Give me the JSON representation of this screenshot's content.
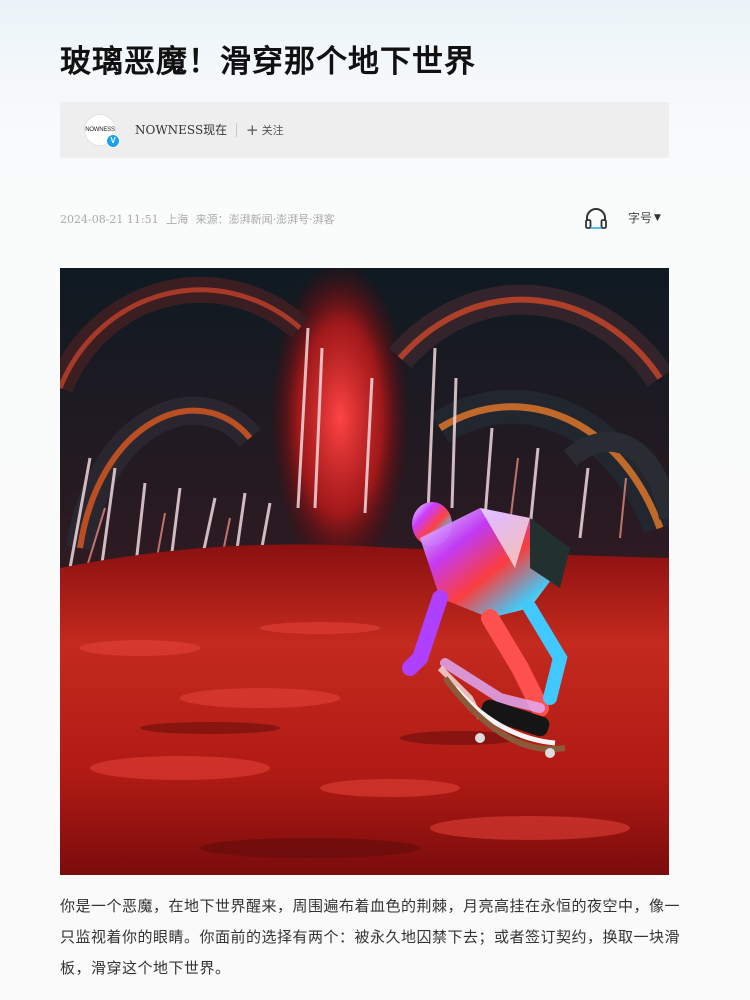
{
  "article": {
    "title": "玻璃恶魔！滑穿那个地下世界",
    "author": {
      "avatar_text": "NOWNESS",
      "verified_badge": "V",
      "name": "NOWNESS现在",
      "follow_label": "关注",
      "follow_icon": "plus-icon"
    },
    "meta": {
      "datetime": "2024-08-21 11:51",
      "location": "上海",
      "source": "来源：澎湃新闻·澎湃号·湃客"
    },
    "toolbar": {
      "audio_icon": "headphone-icon",
      "font_size_label": "字号",
      "font_size_icon": "caret-down-icon"
    },
    "hero_image": {
      "subject": "glass-demon-skateboarder-illustration"
    },
    "body": "你是一个恶魔，在地下世界醒来，周围遍布着血色的荆棘，月亮高挂在永恒的夜空中，像一只监视着你的眼睛。你面前的选择有两个：被永久地囚禁下去；或者签订契约，换取一块滑板，滑穿这个地下世界。"
  },
  "colors": {
    "badge": "#1aa3e8",
    "card_background": "#eeeeee",
    "meta_text": "#aaaaaa"
  }
}
